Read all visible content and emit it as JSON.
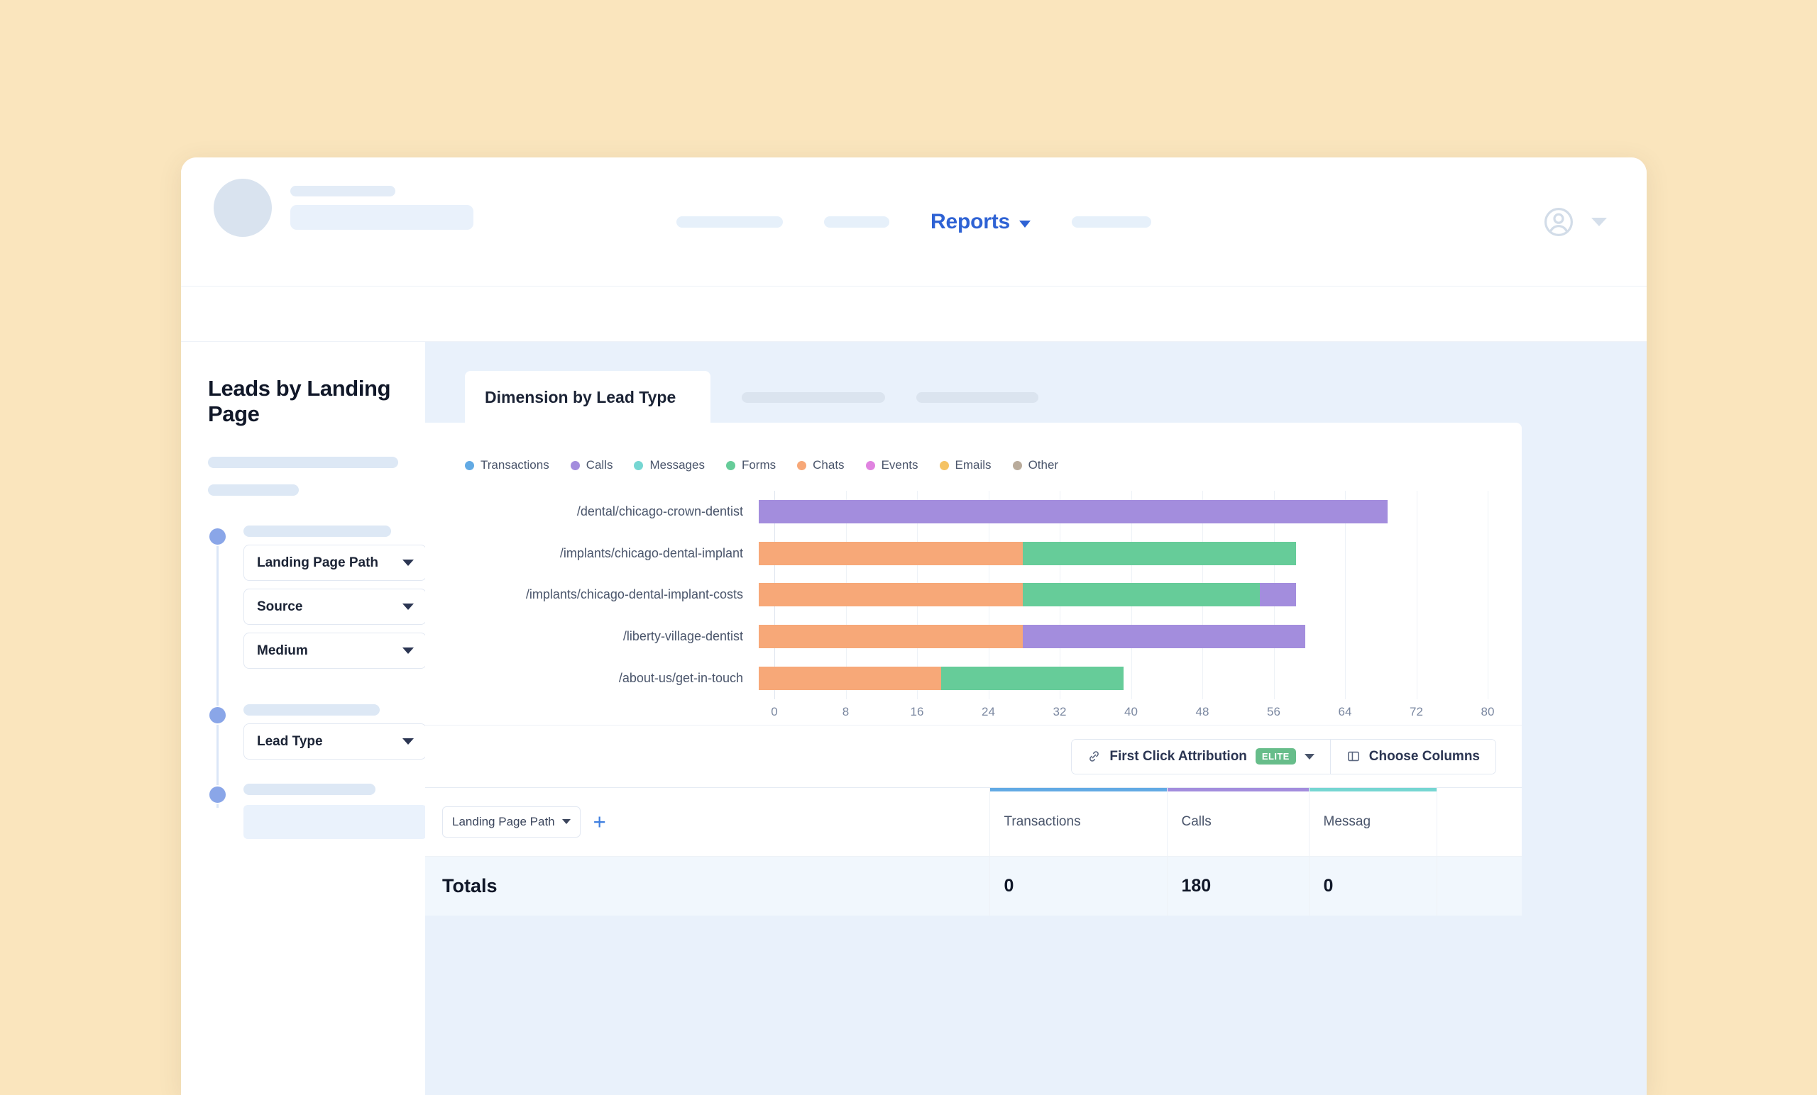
{
  "page": {
    "background_color": "#fae5bd"
  },
  "topnav": {
    "active_item": "Reports",
    "account_icon": "user-circle-icon",
    "caret_icon": "chevron-down-icon"
  },
  "sidebar": {
    "title": "Leads by Landing Page",
    "selects": [
      {
        "label": "Landing Page Path"
      },
      {
        "label": "Source"
      },
      {
        "label": "Medium"
      },
      {
        "label": "Lead Type"
      }
    ]
  },
  "main": {
    "active_tab": "Dimension by Lead Type"
  },
  "toolbar": {
    "attribution_label": "First Click Attribution",
    "attribution_badge": "ELITE",
    "attribution_icon": "link-icon",
    "columns_label": "Choose Columns",
    "columns_icon": "columns-icon"
  },
  "table": {
    "dimension_chip": "Landing Page Path",
    "add_icon": "plus-icon",
    "columns": [
      {
        "label": "Transactions",
        "color": "#62aae4"
      },
      {
        "label": "Calls",
        "color": "#a38ddd"
      },
      {
        "label": "Messag",
        "color": "#76d6d2"
      }
    ],
    "totals_label": "Totals",
    "totals": [
      "0",
      "180",
      "0"
    ]
  },
  "chart_data": {
    "type": "bar",
    "orientation": "horizontal",
    "stacked": true,
    "title": "Dimension by Lead Type",
    "xlabel": "",
    "ylabel": "",
    "xlim": [
      0,
      80
    ],
    "xticks": [
      0,
      8,
      16,
      24,
      32,
      40,
      48,
      56,
      64,
      72,
      80
    ],
    "grid": true,
    "legend_position": "top-left",
    "categories": [
      "/dental/chicago-crown-dentist",
      "/implants/chicago-dental-implant",
      "/implants/chicago-dental-implant-costs",
      "/liberty-village-dentist",
      "/about-us/get-in-touch"
    ],
    "series": [
      {
        "name": "Transactions",
        "color": "#62aae4",
        "values": [
          0,
          0,
          0,
          0,
          0
        ]
      },
      {
        "name": "Calls",
        "color": "#a38ddd",
        "values": [
          69,
          0,
          4,
          31,
          0
        ]
      },
      {
        "name": "Messages",
        "color": "#76d6d2",
        "values": [
          0,
          0,
          0,
          0,
          0
        ]
      },
      {
        "name": "Forms",
        "color": "#66cc99",
        "values": [
          0,
          30,
          26,
          0,
          20
        ]
      },
      {
        "name": "Chats",
        "color": "#f7a878",
        "values": [
          0,
          29,
          29,
          29,
          20
        ]
      },
      {
        "name": "Events",
        "color": "#e083e0",
        "values": [
          0,
          0,
          0,
          0,
          0
        ]
      },
      {
        "name": "Emails",
        "color": "#f5c364",
        "values": [
          0,
          0,
          0,
          0,
          0
        ]
      },
      {
        "name": "Other",
        "color": "#b9ab9b",
        "values": [
          0,
          0,
          0,
          0,
          0
        ]
      }
    ]
  }
}
